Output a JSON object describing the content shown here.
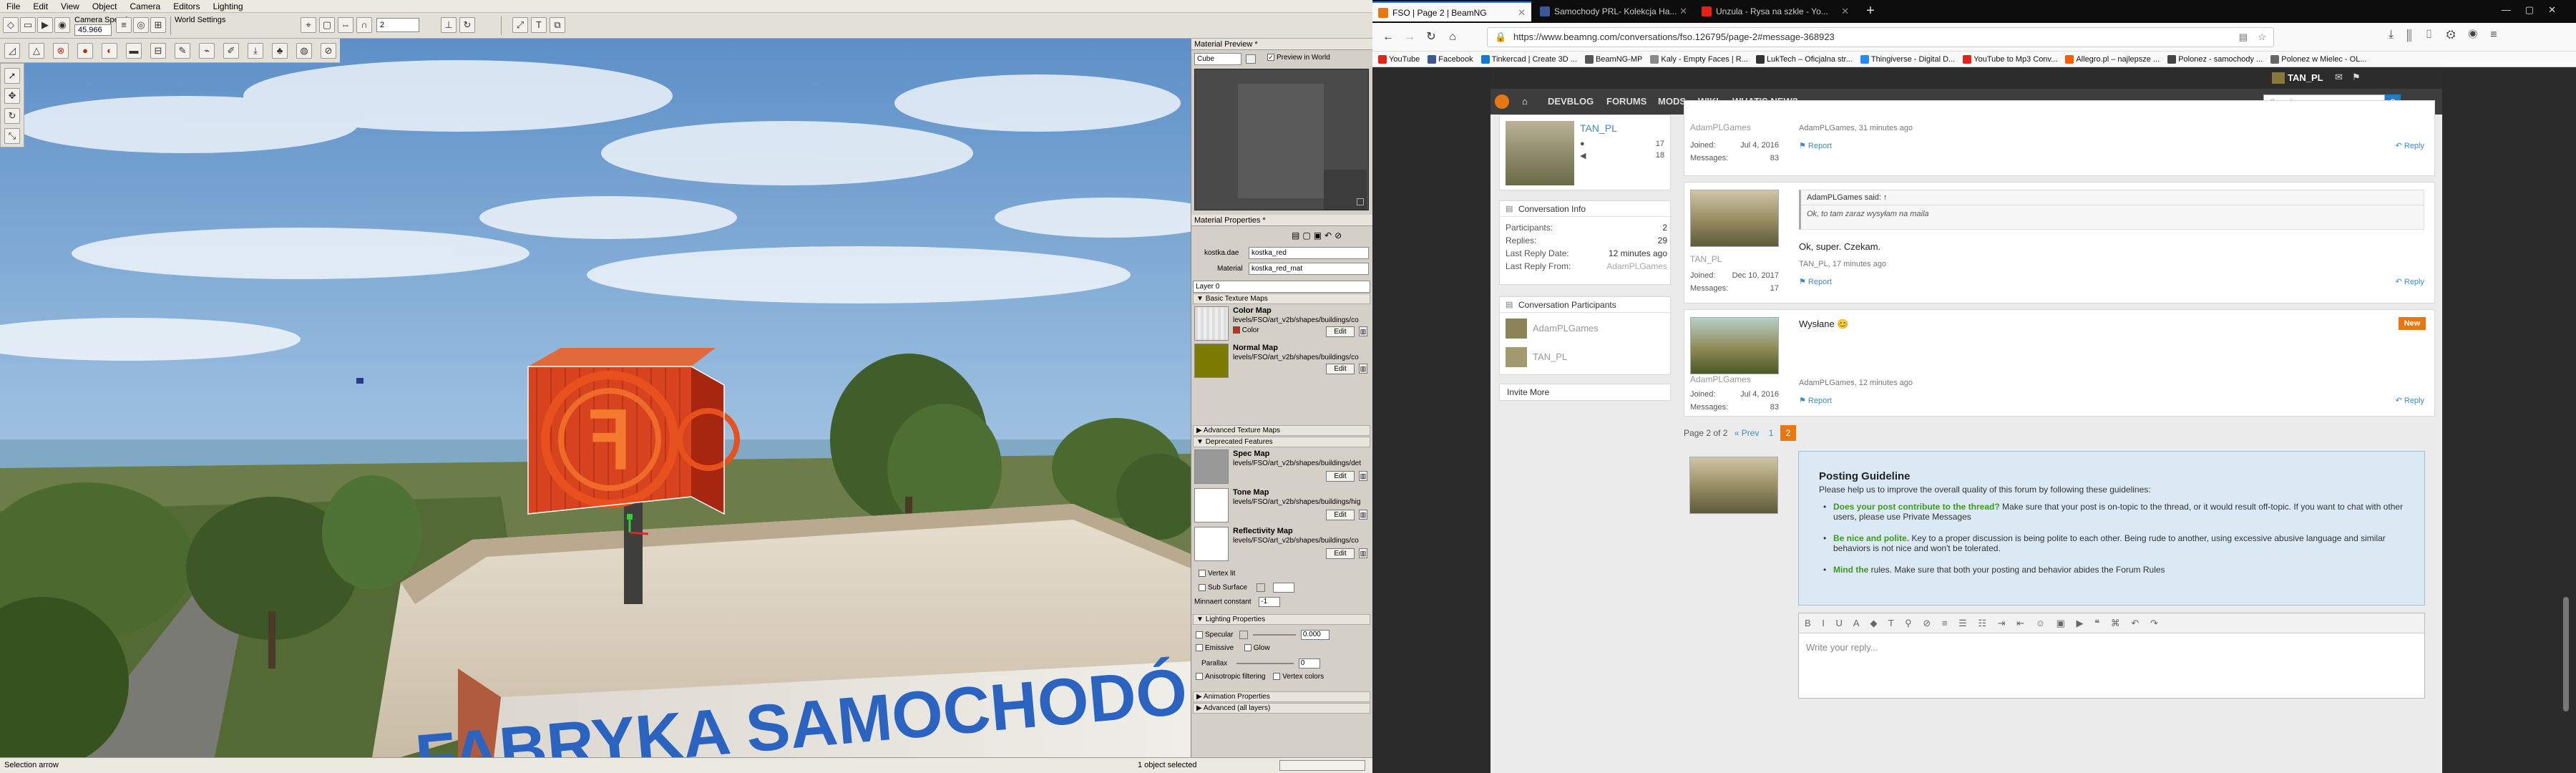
{
  "editor": {
    "menu": [
      "File",
      "Edit",
      "View",
      "Object",
      "Camera",
      "Editors",
      "Lighting"
    ],
    "toolbar": {
      "camera_speed_label": "Camera Speed",
      "camera_speed_value": "45.966",
      "world_settings_label": "World Settings",
      "snap_value": "2"
    },
    "scene": {
      "banner_text": "FABRYKA SAMOCHODÓ"
    },
    "material_preview": {
      "title": "Material Preview *",
      "shape": "Cube",
      "preview_in_world": "Preview in World"
    },
    "material_properties": {
      "title": "Material Properties *",
      "file_label": "kostka.dae",
      "file_value": "kostka_red",
      "material_label": "Material",
      "material_value": "kostka_red_mat",
      "layer": "Layer 0",
      "basic_section": "Basic Texture Maps",
      "maps_basic": [
        {
          "name": "Color Map",
          "path": "levels/FSO/art_v2b/shapes/buildings/co",
          "sub": "Color"
        },
        {
          "name": "Normal Map",
          "path": "levels/FSO/art_v2b/shapes/buildings/co",
          "sub": ""
        }
      ],
      "advanced_section": "Advanced Texture Maps",
      "deprecated_section": "Deprecated Features",
      "maps_deprecated": [
        {
          "name": "Spec Map",
          "path": "levels/FSO/art_v2b/shapes/buildings/det"
        },
        {
          "name": "Tone Map",
          "path": "levels/FSO/art_v2b/shapes/buildings/hig"
        },
        {
          "name": "Reflectivity Map",
          "path": "levels/FSO/art_v2b/shapes/buildings/co"
        }
      ],
      "vertex_lit": "Vertex lit",
      "sub_surface": "Sub Surface",
      "minnaert": "Minnaert constant",
      "minnaert_value": "-1",
      "lighting_section": "Lighting Properties",
      "specular": "Specular",
      "specular_value": "0.000",
      "emissive": "Emissive",
      "glow": "Glow",
      "parallax": "Parallax",
      "parallax_value": "0",
      "anisotropic": "Anisotropic filtering",
      "vertex_colors": "Vertex colors",
      "animation_section": "Animation Properties",
      "advanced_all_section": "Advanced (all layers)",
      "edit_label": "Edit"
    },
    "status": {
      "left": "Selection arrow",
      "center": "1 object selected"
    }
  },
  "browser": {
    "tabs": [
      {
        "title": "FSO | Page 2 | BeamNG",
        "active": true,
        "icon_color": "#e8770f"
      },
      {
        "title": "Samochody PRL- Kolekcja Ha...",
        "active": false,
        "icon_color": "#3b5998"
      },
      {
        "title": "Unzula - Rysa na szkle - Yo...",
        "active": false,
        "icon_color": "#e62117"
      }
    ],
    "new_tab": "+",
    "url": "https://www.beamng.com/conversations/fso.12679​5/page-2#message-368923",
    "bookmarks": [
      {
        "label": "YouTube",
        "color": "#e62117"
      },
      {
        "label": "Facebook",
        "color": "#3b5998"
      },
      {
        "label": "Tinkercad | Create 3D ...",
        "color": "#1477d1"
      },
      {
        "label": "BeamNG-MP",
        "color": "#555"
      },
      {
        "label": "Kaly - Empty Faces | R...",
        "color": "#888"
      },
      {
        "label": "LukTech – Oficjalna str...",
        "color": "#333"
      },
      {
        "label": "Thingiverse - Digital D...",
        "color": "#248bfb"
      },
      {
        "label": "YouTube to Mp3 Conv...",
        "color": "#e62117"
      },
      {
        "label": "Allegro.pl – najlepsze ...",
        "color": "#ff5a00"
      },
      {
        "label": "Polonez - samochody ...",
        "color": "#444"
      },
      {
        "label": "Polonez w Mielec - OL...",
        "color": "#666"
      }
    ],
    "site": {
      "username_top": "TAN_PL",
      "nav": [
        "DEVBLOG",
        "FORUMS",
        "MODS",
        "WIKI",
        "WHAT'S NEW?"
      ],
      "search_placeholder": "Search..."
    },
    "sidebar": {
      "top_user": {
        "name": "TAN_PL",
        "stat1": "17",
        "stat2": "18"
      },
      "conv_info": {
        "title": "Conversation Info",
        "rows": [
          {
            "label": "Participants:",
            "value": "2"
          },
          {
            "label": "Replies:",
            "value": "29"
          },
          {
            "label": "Last Reply Date:",
            "value": "12 minutes ago"
          },
          {
            "label": "Last Reply From:",
            "value": "AdamPLGames"
          }
        ]
      },
      "participants": {
        "title": "Conversation Participants",
        "users": [
          "AdamPLGames",
          "TAN_PL"
        ]
      },
      "invite": "Invite More"
    },
    "messages": [
      {
        "user": "AdamPLGames",
        "joined_label": "Joined:",
        "joined": "Jul 4, 2016",
        "messages_label": "Messages:",
        "messages": "83",
        "footer": "AdamPLGames, 31 minutes ago",
        "body": "",
        "quote_author": "",
        "quote": ""
      },
      {
        "user": "TAN_PL",
        "joined_label": "Joined:",
        "joined": "Dec 10, 2017",
        "messages_label": "Messages:",
        "messages": "17",
        "quote_author": "AdamPLGames said: ↑",
        "quote": "Ok, to tam zaraz wysyłam na maila",
        "body": "Ok, super. Czekam.",
        "footer": "TAN_PL, 17 minutes ago"
      },
      {
        "user": "AdamPLGames",
        "joined_label": "Joined:",
        "joined": "Jul 4, 2016",
        "messages_label": "Messages:",
        "messages": "83",
        "body": "Wysłane 😊",
        "footer": "AdamPLGames, 12 minutes ago",
        "badge": "New",
        "quote_author": "",
        "quote": ""
      }
    ],
    "report_label": "Report",
    "reply_label": "Reply",
    "pagination": {
      "text": "Page 2 of 2",
      "prev": "« Prev",
      "p1": "1",
      "current": "2"
    },
    "guideline": {
      "title": "Posting Guideline",
      "intro": "Please help us to improve the overall quality of this forum by following these guidelines:",
      "items": [
        {
          "strong": "Does your post contribute to the thread?",
          "rest": " Make sure that your post is on-topic to the thread, or it would result off-topic. If you want to chat with other users, please use Private Messages"
        },
        {
          "strong": "Be nice and polite.",
          "rest": " Key to a proper discussion is being polite to each other. Being rude to another, using excessive abusive language and similar behaviors is not nice and won't be tolerated."
        },
        {
          "strong": "Mind the",
          "rest": " rules. Make sure that both your posting and behavior abides the Forum Rules"
        }
      ]
    },
    "reply_placeholder": "Write your reply..."
  }
}
